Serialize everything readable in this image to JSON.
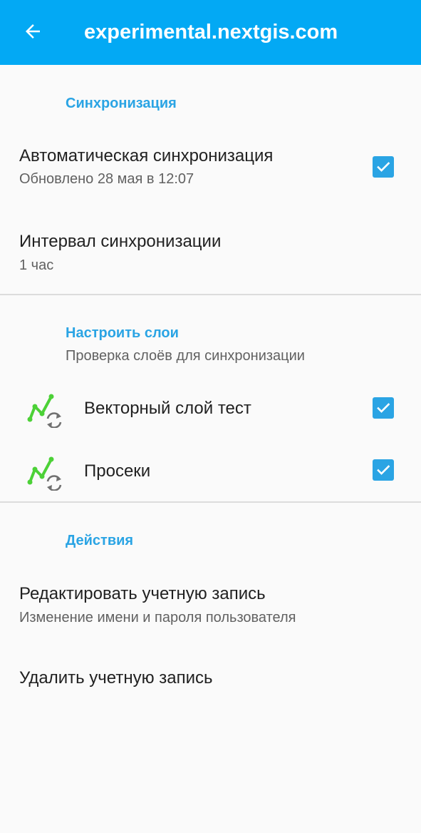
{
  "appbar": {
    "title": "experimental.nextgis.com",
    "back_icon": "arrow-left-icon",
    "background_color": "#03a9f4"
  },
  "accent_color": "#2aa4e4",
  "sync_section": {
    "header": "Синхронизация",
    "auto_sync": {
      "title": "Автоматическая синхронизация",
      "summary": "Обновлено 28 мая в 12:07",
      "checked": true
    },
    "interval": {
      "title": "Интервал синхронизации",
      "summary": "1 час"
    }
  },
  "layers_section": {
    "header": "Настроить слои",
    "subtitle": "Проверка слоёв для синхронизации",
    "layers": [
      {
        "name": "Векторный слой тест",
        "icon": "vector-layer-sync-icon",
        "checked": true
      },
      {
        "name": "Просеки",
        "icon": "vector-layer-sync-icon",
        "checked": true
      }
    ]
  },
  "actions_section": {
    "header": "Действия",
    "edit_account": {
      "title": "Редактировать учетную запись",
      "summary": "Изменение имени и пароля пользователя"
    },
    "delete_account": {
      "title": "Удалить учетную запись"
    }
  }
}
